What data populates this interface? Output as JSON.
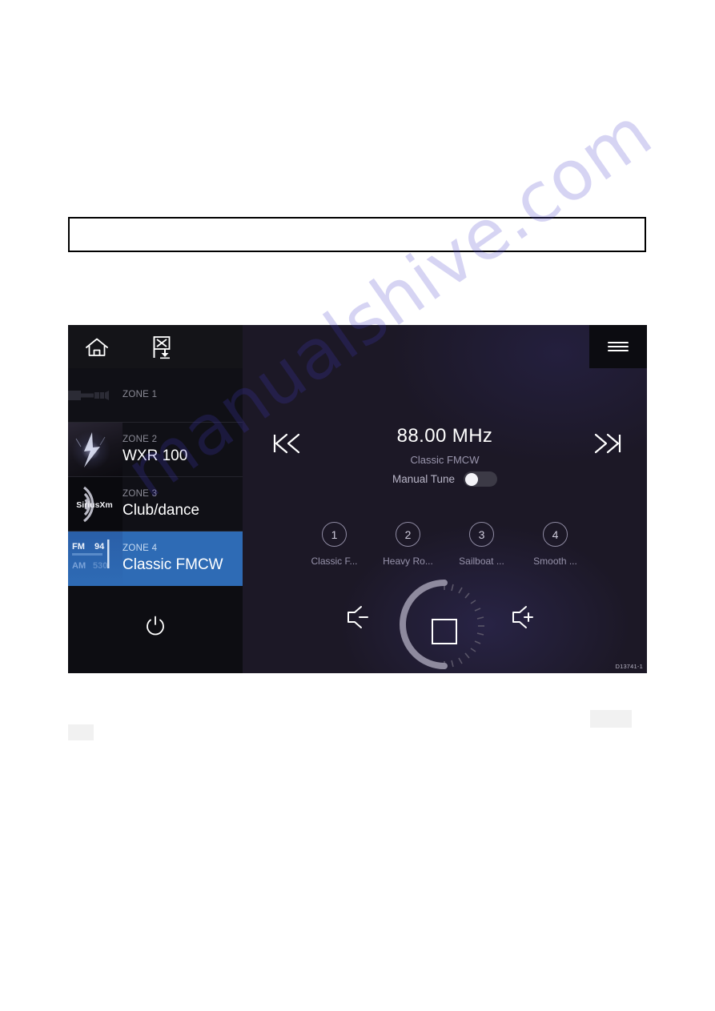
{
  "page": {
    "watermark": "manualshive.com",
    "empty_box_present": true
  },
  "device": {
    "id_code": "D13741-1",
    "toolbar": {
      "home_icon": "home-icon",
      "mob_icon": "man-overboard-flag-icon",
      "menu_icon": "hamburger-menu-icon"
    },
    "sidebar": {
      "zones": [
        {
          "label": "ZONE 1",
          "source": "",
          "thumb": "aux-cable-icon",
          "selected": false,
          "active": false
        },
        {
          "label": "ZONE 2",
          "source": "WXR 100",
          "thumb": "storm-weather-art",
          "selected": false,
          "active": true
        },
        {
          "label": "ZONE 3",
          "source": "Club/dance",
          "thumb": "siriusxm-logo",
          "thumb_text": "SiriusXm",
          "selected": false,
          "active": true
        },
        {
          "label": "ZONE 4",
          "source": "Classic FMCW",
          "thumb": "fm-radio-dial-art",
          "thumb_fm": "FM",
          "thumb_fm_num": "94",
          "thumb_am": "AM",
          "thumb_am_num": "530",
          "selected": true,
          "active": true
        }
      ],
      "power_icon": "power-button-icon"
    },
    "player": {
      "prev_icon": "skip-previous-icon",
      "next_icon": "skip-next-icon",
      "frequency": "88.00 MHz",
      "station_name": "Classic FMCW",
      "manual_tune_label": "Manual Tune",
      "manual_tune_on": false,
      "presets": [
        {
          "number": "1",
          "label": "Classic F..."
        },
        {
          "number": "2",
          "label": "Heavy Ro..."
        },
        {
          "number": "3",
          "label": "Sailboat ..."
        },
        {
          "number": "4",
          "label": "Smooth ..."
        }
      ],
      "volume": {
        "down_icon": "volume-down-icon",
        "up_icon": "volume-up-icon",
        "stop_icon": "stop-square-icon",
        "arc_fill_percent": 38
      }
    },
    "colors": {
      "panel_bg": "#1c1826",
      "sidebar_bg": "#0d0d12",
      "selected_zone": "#2e6bb5",
      "text_primary": "#ffffff",
      "text_muted": "#9793ab"
    }
  }
}
